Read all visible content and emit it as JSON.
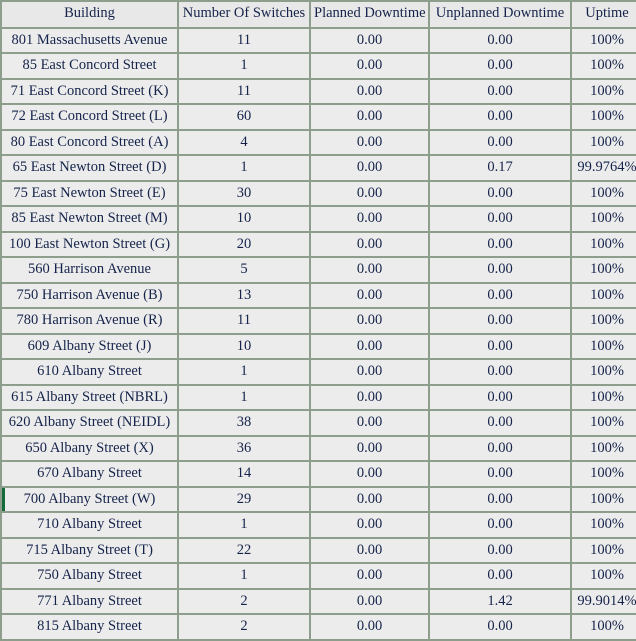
{
  "table": {
    "name": "building-uptime-table",
    "columns": [
      {
        "key": "building",
        "label": "Building"
      },
      {
        "key": "switches",
        "label": "Number Of Switches"
      },
      {
        "key": "planned",
        "label": "Planned Downtime"
      },
      {
        "key": "unplanned",
        "label": "Unplanned Downtime"
      },
      {
        "key": "uptime",
        "label": "Uptime"
      }
    ],
    "colors": {
      "border": "#8d9e8d",
      "cell_background": "#ececec",
      "alt_tint": "#e6e3ec",
      "alert_background": "#f2b2a3",
      "text": "#15234a",
      "row_marker": "#176b3a"
    },
    "rows": [
      {
        "building": "801 Massachusetts Avenue",
        "switches": "11",
        "planned": "0.00",
        "unplanned": "0.00",
        "uptime": "100%",
        "tint": [
          "planned",
          "uptime"
        ],
        "alert": [],
        "marked": false
      },
      {
        "building": "85 East Concord Street",
        "switches": "1",
        "planned": "0.00",
        "unplanned": "0.00",
        "uptime": "100%",
        "tint": [],
        "alert": [],
        "marked": false
      },
      {
        "building": "71 East Concord Street (K)",
        "switches": "11",
        "planned": "0.00",
        "unplanned": "0.00",
        "uptime": "100%",
        "tint": [],
        "alert": [],
        "marked": false
      },
      {
        "building": "72 East Concord Street (L)",
        "switches": "60",
        "planned": "0.00",
        "unplanned": "0.00",
        "uptime": "100%",
        "tint": [
          "planned"
        ],
        "alert": [],
        "marked": false
      },
      {
        "building": "80 East Concord Street (A)",
        "switches": "4",
        "planned": "0.00",
        "unplanned": "0.00",
        "uptime": "100%",
        "tint": [],
        "alert": [],
        "marked": false
      },
      {
        "building": "65 East Newton Street (D)",
        "switches": "1",
        "planned": "0.00",
        "unplanned": "0.17",
        "uptime": "99.9764%",
        "tint": [],
        "alert": [
          "unplanned",
          "uptime"
        ],
        "marked": false
      },
      {
        "building": "75 East Newton Street (E)",
        "switches": "30",
        "planned": "0.00",
        "unplanned": "0.00",
        "uptime": "100%",
        "tint": [
          "unplanned",
          "uptime"
        ],
        "alert": [],
        "marked": false
      },
      {
        "building": "85 East Newton Street (M)",
        "switches": "10",
        "planned": "0.00",
        "unplanned": "0.00",
        "uptime": "100%",
        "tint": [],
        "alert": [],
        "marked": false
      },
      {
        "building": "100 East Newton Street (G)",
        "switches": "20",
        "planned": "0.00",
        "unplanned": "0.00",
        "uptime": "100%",
        "tint": [],
        "alert": [],
        "marked": false
      },
      {
        "building": "560 Harrison Avenue",
        "switches": "5",
        "planned": "0.00",
        "unplanned": "0.00",
        "uptime": "100%",
        "tint": [
          "planned"
        ],
        "alert": [],
        "marked": false
      },
      {
        "building": "750 Harrison Avenue (B)",
        "switches": "13",
        "planned": "0.00",
        "unplanned": "0.00",
        "uptime": "100%",
        "tint": [
          "unplanned"
        ],
        "alert": [],
        "marked": false
      },
      {
        "building": "780 Harrison Avenue (R)",
        "switches": "11",
        "planned": "0.00",
        "unplanned": "0.00",
        "uptime": "100%",
        "tint": [],
        "alert": [],
        "marked": false
      },
      {
        "building": "609 Albany Street (J)",
        "switches": "10",
        "planned": "0.00",
        "unplanned": "0.00",
        "uptime": "100%",
        "tint": [
          "unplanned"
        ],
        "alert": [],
        "marked": false
      },
      {
        "building": "610 Albany Street",
        "switches": "1",
        "planned": "0.00",
        "unplanned": "0.00",
        "uptime": "100%",
        "tint": [
          "planned",
          "uptime"
        ],
        "alert": [],
        "marked": false
      },
      {
        "building": "615 Albany Street (NBRL)",
        "switches": "1",
        "planned": "0.00",
        "unplanned": "0.00",
        "uptime": "100%",
        "tint": [],
        "alert": [],
        "marked": false
      },
      {
        "building": "620 Albany Street (NEIDL)",
        "switches": "38",
        "planned": "0.00",
        "unplanned": "0.00",
        "uptime": "100%",
        "tint": [],
        "alert": [],
        "marked": false
      },
      {
        "building": "650 Albany Street (X)",
        "switches": "36",
        "planned": "0.00",
        "unplanned": "0.00",
        "uptime": "100%",
        "tint": [
          "planned"
        ],
        "alert": [],
        "marked": false
      },
      {
        "building": "670 Albany Street",
        "switches": "14",
        "planned": "0.00",
        "unplanned": "0.00",
        "uptime": "100%",
        "tint": [],
        "alert": [],
        "marked": false
      },
      {
        "building": "700 Albany Street (W)",
        "switches": "29",
        "planned": "0.00",
        "unplanned": "0.00",
        "uptime": "100%",
        "tint": [
          "planned"
        ],
        "alert": [],
        "marked": true
      },
      {
        "building": "710 Albany Street",
        "switches": "1",
        "planned": "0.00",
        "unplanned": "0.00",
        "uptime": "100%",
        "tint": [],
        "alert": [],
        "marked": false
      },
      {
        "building": "715 Albany Street (T)",
        "switches": "22",
        "planned": "0.00",
        "unplanned": "0.00",
        "uptime": "100%",
        "tint": [
          "unplanned",
          "uptime"
        ],
        "alert": [],
        "marked": false
      },
      {
        "building": "750 Albany Street",
        "switches": "1",
        "planned": "0.00",
        "unplanned": "0.00",
        "uptime": "100%",
        "tint": [
          "planned",
          "uptime"
        ],
        "alert": [],
        "marked": false
      },
      {
        "building": "771 Albany Street",
        "switches": "2",
        "planned": "0.00",
        "unplanned": "1.42",
        "uptime": "99.9014%",
        "tint": [],
        "alert": [
          "unplanned",
          "uptime"
        ],
        "marked": false
      },
      {
        "building": "815 Albany Street",
        "switches": "2",
        "planned": "0.00",
        "unplanned": "0.00",
        "uptime": "100%",
        "tint": [],
        "alert": [],
        "marked": false
      }
    ]
  }
}
